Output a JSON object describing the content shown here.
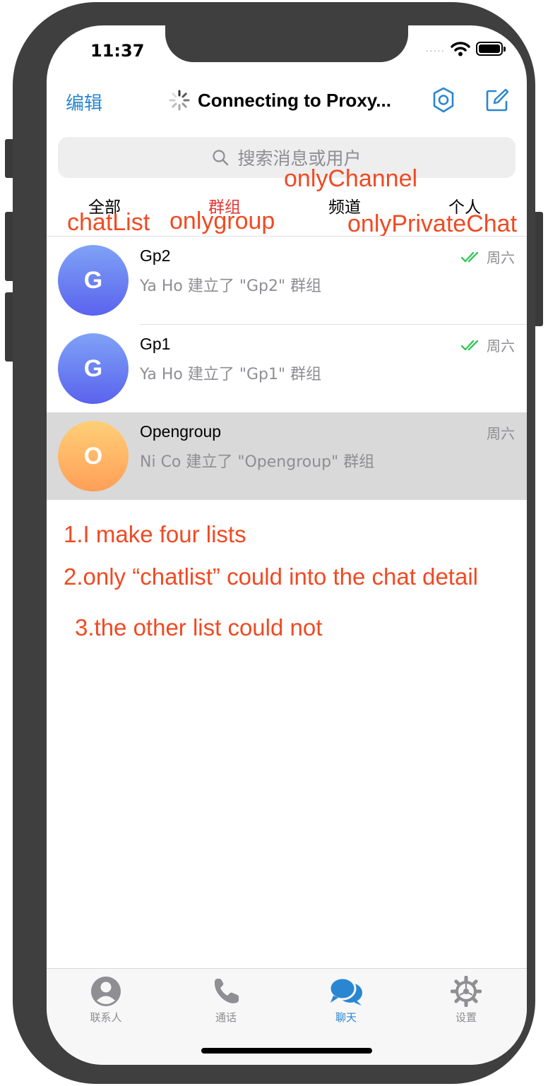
{
  "status_bar": {
    "time": "11:37",
    "signal": "....."
  },
  "nav": {
    "edit_label": "编辑",
    "title": "Connecting to Proxy..."
  },
  "search": {
    "placeholder": "搜索消息或用户"
  },
  "filters": [
    {
      "label": "全部",
      "active": false
    },
    {
      "label": "群组",
      "active": true
    },
    {
      "label": "频道",
      "active": false
    },
    {
      "label": "个人",
      "active": false
    }
  ],
  "annotations": {
    "tab_names": [
      "chatList",
      "onlygroup",
      "onlyChannel",
      "onlyPrivateChat"
    ],
    "notes": [
      "1.I make four lists",
      "2.only “chatlist” could into the chat detail",
      "3.the other list could not"
    ]
  },
  "chats": [
    {
      "initial": "G",
      "title": "Gp2",
      "message": "Ya Ho 建立了 \"Gp2\" 群组",
      "date": "周六",
      "read": true,
      "selected": false
    },
    {
      "initial": "G",
      "title": "Gp1",
      "message": "Ya Ho 建立了 \"Gp1\" 群组",
      "date": "周六",
      "read": true,
      "selected": false
    },
    {
      "initial": "O",
      "title": "Opengroup",
      "message": "Ni Co 建立了 \"Opengroup\" 群组",
      "date": "周六",
      "read": false,
      "selected": true
    }
  ],
  "tabbar": [
    {
      "label": "联系人",
      "icon": "person-circle-icon",
      "active": false
    },
    {
      "label": "通话",
      "icon": "phone-icon",
      "active": false
    },
    {
      "label": "聊天",
      "icon": "chat-bubbles-icon",
      "active": true
    },
    {
      "label": "设置",
      "icon": "gear-icon",
      "active": false
    }
  ],
  "colors": {
    "accent": "#2a86d1",
    "annotation": "#f04a23",
    "active_filter": "#e53935",
    "read_check": "#34c759",
    "selected_row": "#d9d9d9"
  }
}
